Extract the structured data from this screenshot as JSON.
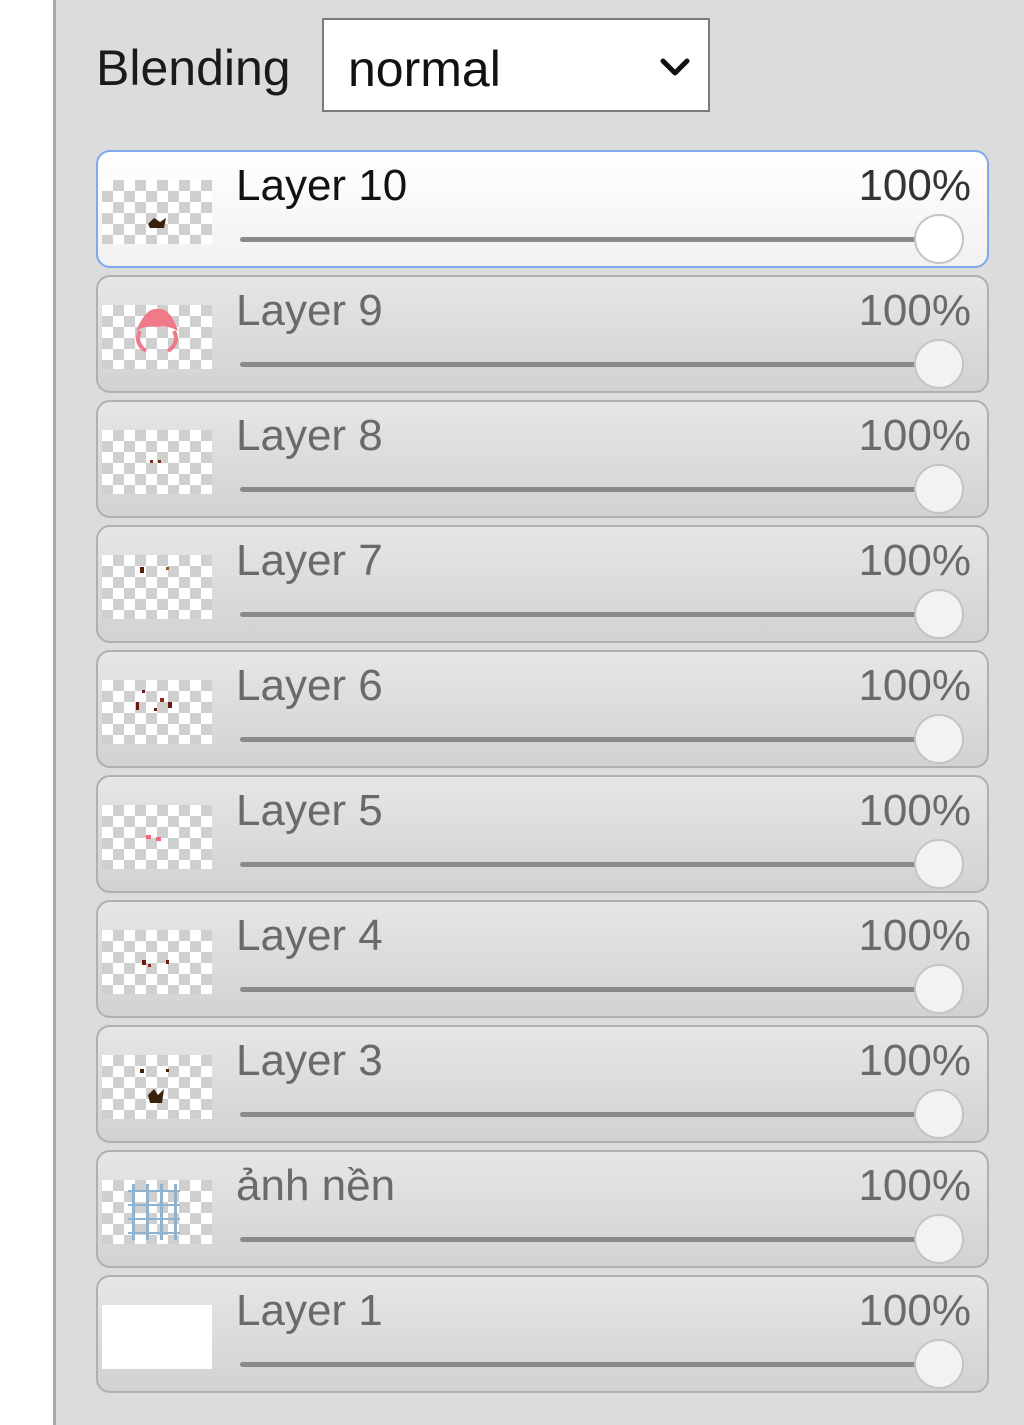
{
  "blending": {
    "label": "Blending",
    "value": "normal"
  },
  "layers": [
    {
      "name": "Layer 10",
      "opacity": "100%",
      "opacity_value": 100,
      "active": true
    },
    {
      "name": "Layer 9",
      "opacity": "100%",
      "opacity_value": 100
    },
    {
      "name": "Layer 8",
      "opacity": "100%",
      "opacity_value": 100
    },
    {
      "name": "Layer 7",
      "opacity": "100%",
      "opacity_value": 100
    },
    {
      "name": "Layer 6",
      "opacity": "100%",
      "opacity_value": 100
    },
    {
      "name": "Layer 5",
      "opacity": "100%",
      "opacity_value": 100
    },
    {
      "name": "Layer 4",
      "opacity": "100%",
      "opacity_value": 100
    },
    {
      "name": "Layer 3",
      "opacity": "100%",
      "opacity_value": 100
    },
    {
      "name": "ảnh nền",
      "opacity": "100%",
      "opacity_value": 100
    },
    {
      "name": "Layer 1",
      "opacity": "100%",
      "opacity_value": 100
    }
  ],
  "colors": {
    "panel": "#dcdcdc",
    "active_border": "#7fa8ee",
    "track": "#8a8a8a"
  }
}
